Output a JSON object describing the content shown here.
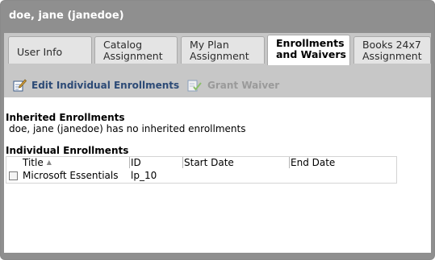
{
  "window": {
    "title": "doe, jane (janedoe)"
  },
  "tabs": [
    {
      "line1": "User Info",
      "line2": ""
    },
    {
      "line1": "Catalog",
      "line2": "Assignment"
    },
    {
      "line1": "My Plan",
      "line2": "Assignment"
    },
    {
      "line1": "Enrollments",
      "line2": "and Waivers"
    },
    {
      "line1": "Books 24x7",
      "line2": "Assignment"
    }
  ],
  "active_tab": "Enrollments and Waivers",
  "toolbar": {
    "edit_label": "Edit Individual Enrollments",
    "grant_label": "Grant Waiver",
    "grant_enabled": false
  },
  "inherited": {
    "title": "Inherited Enrollments",
    "message": "doe, jane (janedoe) has no inherited enrollments"
  },
  "individual": {
    "title": "Individual Enrollments",
    "columns": [
      "Title",
      "ID",
      "Start Date",
      "End Date"
    ],
    "sort_column": "Title",
    "sort_direction": "ascending",
    "rows": [
      {
        "title": "Microsoft Essentials",
        "id": "lp_10",
        "start": "",
        "end": "",
        "checked": false
      }
    ]
  },
  "colors": {
    "frame": "#8f8f8f",
    "tabbar": "#c7c7c7",
    "link": "#2c4a76",
    "disabled": "#9a9a9a"
  }
}
